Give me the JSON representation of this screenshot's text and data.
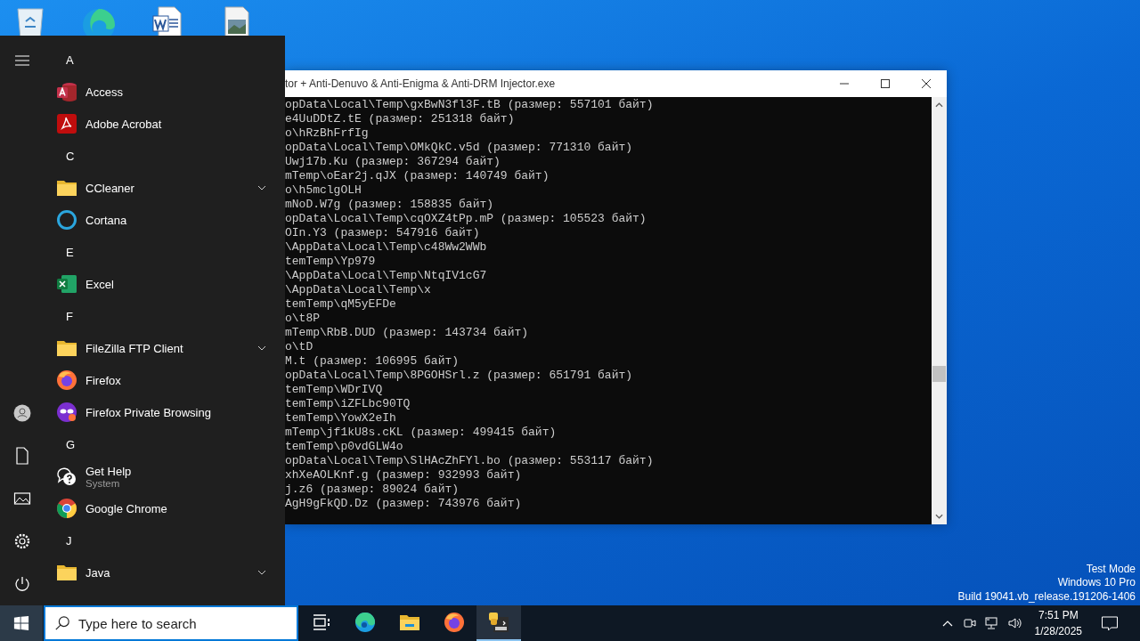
{
  "desktop": {
    "icons": [
      {
        "kind": "recycle"
      },
      {
        "kind": "edge"
      },
      {
        "kind": "word"
      },
      {
        "kind": "image"
      }
    ],
    "watermark_lines": [
      "Test Mode",
      "Windows 10 Pro",
      "Build 19041.vb_release.191206-1406"
    ]
  },
  "console_window": {
    "title": "tor + Anti-Denuvo & Anti-Enigma & Anti-DRM Injector.exe",
    "lines": [
      "opData\\Local\\Temp\\gxBwN3fl3F.tB (размер: 557101 байт)",
      "e4UuDDtZ.tE (размер: 251318 байт)",
      "o\\hRzBhFrfIg",
      "opData\\Local\\Temp\\OMkQkC.v5d (размер: 771310 байт)",
      "Uwj17b.Ku (размер: 367294 байт)",
      "mTemp\\oEar2j.qJX (размер: 140749 байт)",
      "o\\h5mclgOLH",
      "mNoD.W7g (размер: 158835 байт)",
      "opData\\Local\\Temp\\cqOXZ4tPp.mP (размер: 105523 байт)",
      "OIn.Y3 (размер: 547916 байт)",
      "\\AppData\\Local\\Temp\\c48Ww2WWb",
      "temTemp\\Yp979",
      "\\AppData\\Local\\Temp\\NtqIV1cG7",
      "\\AppData\\Local\\Temp\\x",
      "temTemp\\qM5yEFDe",
      "o\\t8P",
      "mTemp\\RbB.DUD (размер: 143734 байт)",
      "o\\tD",
      "M.t (размер: 106995 байт)",
      "opData\\Local\\Temp\\8PGOHSrl.z (размер: 651791 байт)",
      "temTemp\\WDrIVQ",
      "temTemp\\iZFLbc90TQ",
      "temTemp\\YowX2eIh",
      "mTemp\\jf1kU8s.cKL (размер: 499415 байт)",
      "temTemp\\p0vdGLW4o",
      "opData\\Local\\Temp\\SlHAcZhFYl.bo (размер: 553117 байт)",
      "xhXeAOLKnf.g (размер: 932993 байт)",
      "j.z6 (размер: 89024 байт)",
      "AgH9gFkQD.Dz (размер: 743976 байт)"
    ]
  },
  "start_menu": {
    "items": [
      {
        "kind": "header",
        "label": "A"
      },
      {
        "kind": "access",
        "label": "Access"
      },
      {
        "kind": "acrobat",
        "label": "Adobe Acrobat"
      },
      {
        "kind": "header",
        "label": "C"
      },
      {
        "kind": "folder",
        "label": "CCleaner"
      },
      {
        "kind": "cortana",
        "label": "Cortana"
      },
      {
        "kind": "header",
        "label": "E"
      },
      {
        "kind": "excel",
        "label": "Excel"
      },
      {
        "kind": "header",
        "label": "F"
      },
      {
        "kind": "folder",
        "label": "FileZilla FTP Client"
      },
      {
        "kind": "firefox",
        "label": "Firefox"
      },
      {
        "kind": "private",
        "label": "Firefox Private Browsing"
      },
      {
        "kind": "header",
        "label": "G"
      },
      {
        "kind": "help",
        "label": "Get Help",
        "subtitle": "System"
      },
      {
        "kind": "chrome",
        "label": "Google Chrome"
      },
      {
        "kind": "header",
        "label": "J"
      },
      {
        "kind": "folder",
        "label": "Java"
      }
    ]
  },
  "taskbar": {
    "search": {
      "placeholder": "Type here to search"
    },
    "apps": [
      {
        "kind": "taskview",
        "active": false
      },
      {
        "kind": "edge",
        "active": false
      },
      {
        "kind": "explorer",
        "active": false
      },
      {
        "kind": "firefox",
        "active": false
      },
      {
        "kind": "console",
        "active": true
      }
    ],
    "clock": {
      "time": "7:51 PM",
      "date": "1/28/2025"
    }
  }
}
